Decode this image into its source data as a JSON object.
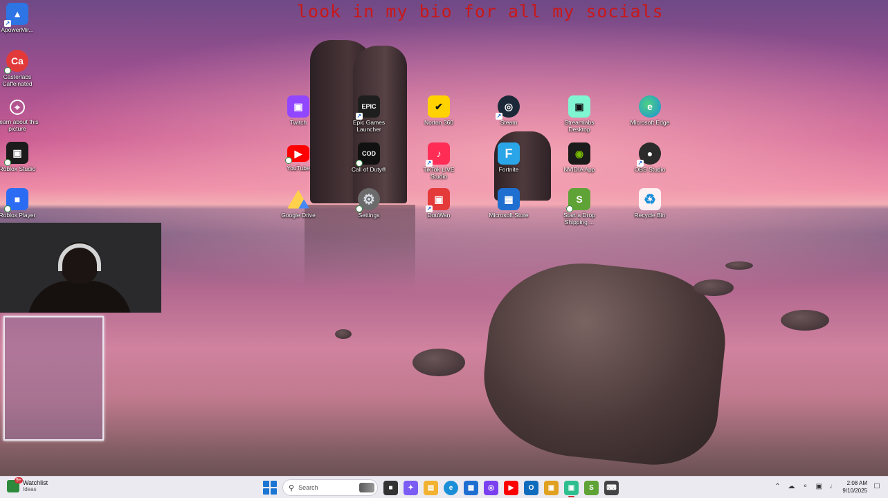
{
  "banner": "look in my bio for all my socials",
  "desktop_left": [
    {
      "label": "ApowerMir...",
      "color": "#2d74e4",
      "glyph": "▲"
    },
    {
      "label": "Casterlabs Caffeinated",
      "color": "#e23a3a",
      "glyph": "Ca"
    },
    {
      "label": "Learn about this picture",
      "color": "transparent",
      "glyph": "⌖"
    },
    {
      "label": "Roblox Studio",
      "color": "#1b1b1b",
      "glyph": "▣"
    },
    {
      "label": "Roblox Player",
      "color": "#2b6cf3",
      "glyph": "■"
    }
  ],
  "desktop_grid": [
    {
      "label": "Twitch",
      "color": "#9146ff",
      "glyph": "▣"
    },
    {
      "label": "Epic Games Launcher",
      "color": "#1e1e1e",
      "glyph": "EPIC"
    },
    {
      "label": "Norton 360",
      "color": "#ffd200",
      "glyph": "✔"
    },
    {
      "label": "Steam",
      "color": "#1b2838",
      "glyph": "◎"
    },
    {
      "label": "Streamlabs Desktop",
      "color": "#80f5d2",
      "glyph": "▣"
    },
    {
      "label": "Microsoft Edge",
      "color": "#1a8fd8",
      "glyph": "e"
    },
    {
      "label": "YouTube",
      "color": "#ff0000",
      "glyph": "▶"
    },
    {
      "label": "Call of Duty®",
      "color": "#111111",
      "glyph": "COD"
    },
    {
      "label": "TikTok LIVE Studio",
      "color": "#ff2d55",
      "glyph": "♪"
    },
    {
      "label": "Fortnite",
      "color": "#2aa5e8",
      "glyph": "F"
    },
    {
      "label": "NVIDIA App",
      "color": "#76b900",
      "glyph": "◉"
    },
    {
      "label": "OBS Studio",
      "color": "#2b2b2b",
      "glyph": "●"
    },
    {
      "label": "Google Drive",
      "color": "transparent",
      "glyph": "▲"
    },
    {
      "label": "Settings",
      "color": "#6b6b6b",
      "glyph": "⚙"
    },
    {
      "label": "DouWan",
      "color": "#e43a3a",
      "glyph": "▣"
    },
    {
      "label": "Microsoft Store",
      "color": "#1f6fd1",
      "glyph": "▦"
    },
    {
      "label": "Start a Drop Shipping ...",
      "color": "#5fa336",
      "glyph": "S"
    },
    {
      "label": "Recycle Bin",
      "color": "transparent",
      "glyph": "♻"
    }
  ],
  "taskbar": {
    "widget_title": "Watchlist",
    "widget_sub": "Ideas",
    "widget_badge": "9+",
    "search_placeholder": "Search",
    "apps": [
      {
        "name": "task-view",
        "color": "#333333",
        "glyph": "■"
      },
      {
        "name": "copilot",
        "color": "#7b5cf5",
        "glyph": "✦"
      },
      {
        "name": "file-explorer",
        "color": "#f2b230",
        "glyph": "▤"
      },
      {
        "name": "edge",
        "color": "#1a8fd8",
        "glyph": "e"
      },
      {
        "name": "microsoft-store",
        "color": "#1f6fd1",
        "glyph": "▦"
      },
      {
        "name": "app-purple",
        "color": "#7a3ff0",
        "glyph": "◎"
      },
      {
        "name": "youtube",
        "color": "#ff0000",
        "glyph": "▶"
      },
      {
        "name": "outlook",
        "color": "#0f6cbd",
        "glyph": "O"
      },
      {
        "name": "app-colorful",
        "color": "#e0a020",
        "glyph": "▣"
      },
      {
        "name": "streamlabs",
        "color": "#2fbf8f",
        "glyph": "▣"
      },
      {
        "name": "shopify",
        "color": "#5fa336",
        "glyph": "S"
      },
      {
        "name": "keyboard",
        "color": "#444444",
        "glyph": "⌨"
      }
    ],
    "time": "2:08 AM",
    "date": "9/10/2025"
  }
}
